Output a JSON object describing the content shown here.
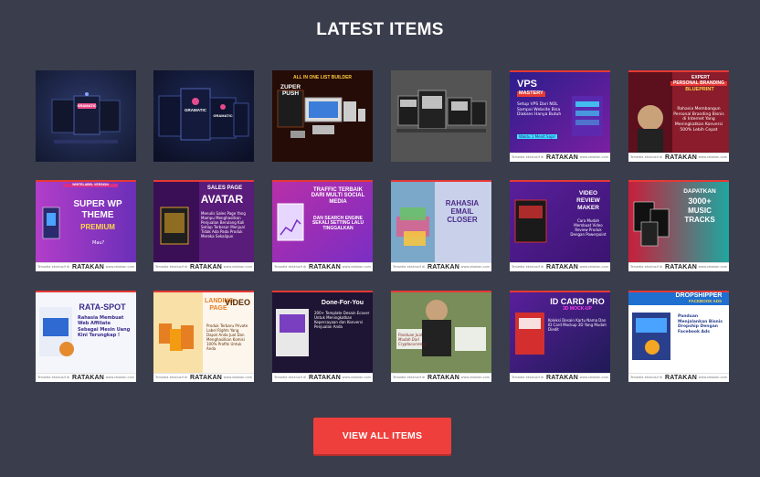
{
  "section": {
    "title": "LATEST ITEMS"
  },
  "footer_common": {
    "left": "Tersedia eksklusif di",
    "brand": "RATAKAN",
    "url": "www.ratakan.com"
  },
  "items": [
    {
      "name": "gramatic-product-boxes-1",
      "texts": [
        "GRAMATIC"
      ]
    },
    {
      "name": "gramatic-product-boxes-2",
      "texts": [
        "GRAMATIC",
        "GRAMATIC"
      ]
    },
    {
      "name": "zuper-push-list-builder",
      "texts": [
        "ALL IN ONE LIST BUILDER",
        "ZUPER PUSH"
      ]
    },
    {
      "name": "dark-product-bundle",
      "texts": []
    },
    {
      "name": "vps-mastery",
      "texts": [
        "VPS",
        "MASTERY",
        "Setup VPS Dari NOL Sampai Website Bisa Diakses Hanya Butuh",
        "Waktu 1 Menit Saja!"
      ]
    },
    {
      "name": "expert-personal-branding",
      "texts": [
        "EXPERT",
        "PERSONAL BRANDING",
        "BLUEPRINT",
        "Rahasia Membangun Personal Branding Bisnis di Internet Yang Meningkatkan Konversi 500% Lebih Cepat"
      ]
    },
    {
      "name": "super-wp-theme-premium",
      "texts": [
        "WHITELABEL VERSION",
        "SUPER WP",
        "THEME",
        "PREMIUM",
        "Mau?"
      ]
    },
    {
      "name": "sales-page-avatar",
      "texts": [
        "SALES PAGE",
        "AVATAR",
        "Menulis Sales Page Yang Mampu Menghasilkan Penjualan Berulang Kali Setiap Terbesar Menjual Tidak Ada Pada Produk Mereka Sekalipun"
      ]
    },
    {
      "name": "traffic-social-media",
      "texts": [
        "TRAFFIC TERBAIK DARI MULTI SOCIAL MEDIA",
        "DAN SEARCH ENGINE SEKALI SETTING LALU TINGGALKAN"
      ]
    },
    {
      "name": "rahasia-email-closer",
      "texts": [
        "RAHASIA",
        "EMAIL",
        "CLOSER"
      ]
    },
    {
      "name": "video-review-maker",
      "texts": [
        "VIDEO",
        "REVIEW",
        "MAKER",
        "Cara Mudah Membuat Video Review Produk Dengan Powerpoint"
      ]
    },
    {
      "name": "music-tracks",
      "texts": [
        "DAPATKAN",
        "3000+",
        "MUSIC",
        "TRACKS"
      ]
    },
    {
      "name": "rata-spot",
      "texts": [
        "RATA-SPOT",
        "Rahasia Membuat Web Affiliate Sebagai Mesin Uang Kini Terungkap !"
      ]
    },
    {
      "name": "landing-page-video",
      "texts": [
        "LANDING",
        "PAGE",
        "VIDEO",
        "Produk Terbaru Private Label Rights Yang Dapat Anda Jual Dan Menghasilkan Komisi 100% Profits Untuk Anda"
      ]
    },
    {
      "name": "done-for-you-templates",
      "texts": [
        "Done-For-You",
        "200+ Template Desain Ecover Untuk Meningkatkan Kepercayaan dan Konversi Penjualan Anda"
      ]
    },
    {
      "name": "cryptocurrency-guide",
      "texts": [
        "Panduan Jual Mudah Dari Cryptocurrency"
      ]
    },
    {
      "name": "id-card-pro-mockup",
      "texts": [
        "ID CARD PRO",
        "3D MOCK-UP",
        "Koleksi Desain Kartu Nama Dan ID Card Mockup 3D Yang Mudah Diedit"
      ]
    },
    {
      "name": "dropshipper-facebook-ads",
      "texts": [
        "DROPSHIPPER",
        "FACEBOOK ADS",
        "Panduan Menjalankan Bisnis Dropship Dengan Facebook Ads"
      ]
    }
  ],
  "colors": {
    "background": "#3a3d4b",
    "accent": "#ef3f3c",
    "card_border": "#e53935"
  },
  "view_all": {
    "label": "VIEW ALL ITEMS"
  }
}
